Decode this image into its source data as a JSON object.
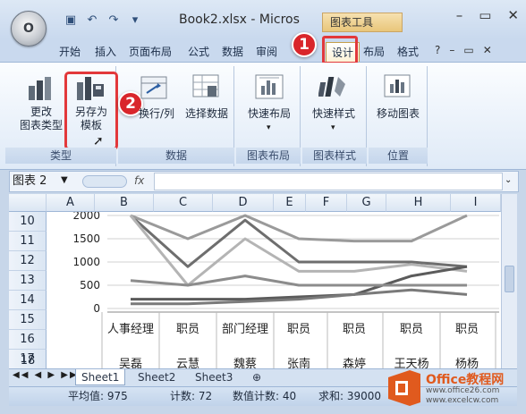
{
  "window": {
    "title": "Book2.xlsx - Micros",
    "chart_tools_label": "图表工具",
    "office_button": "Office"
  },
  "tabs": [
    "开始",
    "插入",
    "页面布局",
    "公式",
    "数据",
    "审阅",
    "设计",
    "布局",
    "格式"
  ],
  "active_tab": "设计",
  "callouts": [
    "1",
    "2"
  ],
  "ribbon": {
    "groups": [
      {
        "label": "类型",
        "buttons": [
          "更改\n图表类型",
          "另存为\n模板"
        ]
      },
      {
        "label": "数据",
        "buttons": [
          "切换行/列",
          "选择数据"
        ]
      },
      {
        "label": "图表布局",
        "buttons": [
          "快速布局"
        ]
      },
      {
        "label": "图表样式",
        "buttons": [
          "快速样式"
        ]
      },
      {
        "label": "位置",
        "buttons": [
          "移动图表"
        ]
      }
    ],
    "change_type": "更改",
    "change_type2": "图表类型",
    "save_template": "另存为",
    "save_template2": "模板",
    "switch_rowcol": "换行/列",
    "select_data": "选择数据",
    "quick_layout": "快速布局",
    "quick_style": "快速样式",
    "move_chart": "移动图表",
    "group_type": "类型",
    "group_data": "数据",
    "group_layout": "图表布局",
    "group_style": "图表样式",
    "group_location": "位置"
  },
  "formula": {
    "name_box": "图表 2",
    "fx": "fx"
  },
  "columns": [
    "A",
    "B",
    "C",
    "D",
    "E",
    "F",
    "G",
    "H",
    "I"
  ],
  "rows": [
    "10",
    "11",
    "12",
    "13",
    "14",
    "15",
    "16",
    "17",
    "18"
  ],
  "chart": {
    "y_ticks": [
      "2000",
      "1500",
      "1000",
      "500",
      "0"
    ],
    "categories": [
      "人事经理",
      "职员",
      "部门经理",
      "职员",
      "职员",
      "职员",
      "职员"
    ],
    "names": [
      "吴磊",
      "云慧",
      "魏蔡",
      "张南",
      "森婷",
      "王天杨",
      "杨杨"
    ]
  },
  "chart_data": {
    "type": "line",
    "categories": [
      "人事经理",
      "职员",
      "部门经理",
      "职员",
      "职员",
      "职员",
      "职员"
    ],
    "ylim": [
      0,
      2000
    ],
    "yticks": [
      0,
      500,
      1000,
      1500,
      2000
    ],
    "series": [
      {
        "values": [
          2000,
          900,
          1900,
          1000,
          1000,
          1000,
          900
        ]
      },
      {
        "values": [
          2000,
          1500,
          2000,
          1500,
          1450,
          1450,
          2000
        ]
      },
      {
        "values": [
          2000,
          500,
          1500,
          800,
          800,
          950,
          800
        ]
      },
      {
        "values": [
          200,
          200,
          200,
          250,
          300,
          700,
          900
        ]
      },
      {
        "values": [
          100,
          100,
          150,
          200,
          300,
          400,
          300
        ]
      },
      {
        "values": [
          600,
          500,
          700,
          500,
          500,
          500,
          500
        ]
      }
    ]
  },
  "sheets": [
    "Sheet1",
    "Sheet2",
    "Sheet3"
  ],
  "active_sheet": "Sheet1",
  "status": {
    "average": "平均值: 975",
    "count": "计数: 72",
    "numeric_count": "数值计数: 40",
    "sum": "求和: 39000"
  },
  "watermark": {
    "brand": "Office教程网",
    "url": "www.office26.com",
    "url2": "www.excelcw.com"
  },
  "colors": {
    "callout": "#d9262b",
    "ribbon_bg": "#dfeaf7",
    "series": [
      "#6e6e6e",
      "#9a9a9a",
      "#b4b4b4",
      "#5b5b5b",
      "#7a7a7a",
      "#8c8c8c"
    ]
  }
}
